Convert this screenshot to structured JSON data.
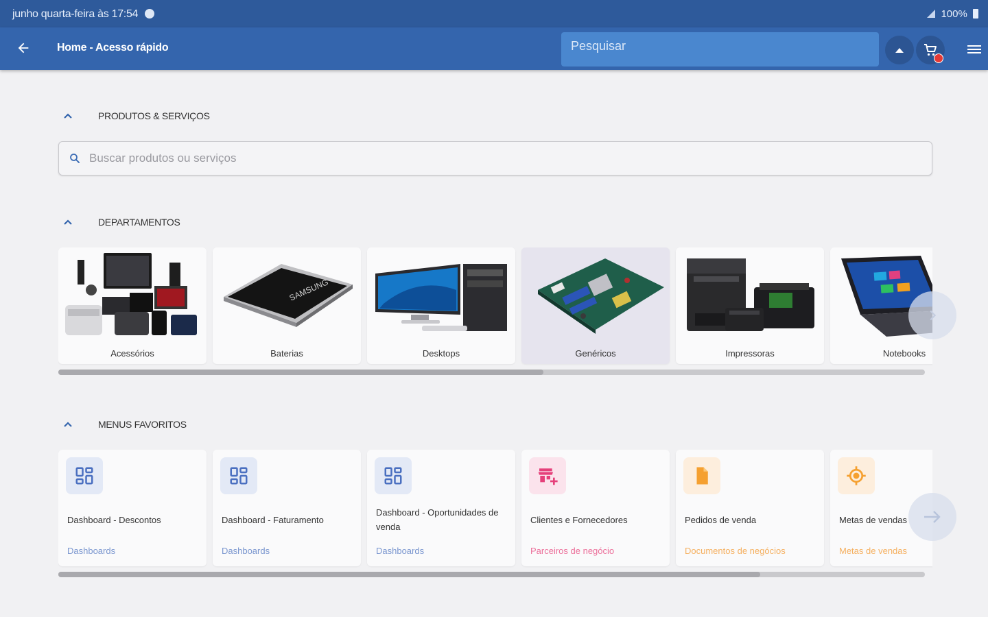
{
  "status_bar": {
    "time_text": "junho quarta-feira às 17:54",
    "battery": "100%"
  },
  "app_bar": {
    "breadcrumb": "Home - Acesso rápido",
    "search_placeholder": "Pesquisar",
    "colors": {
      "bar": "#3465ad",
      "status": "#2e5a9b",
      "search": "#4a87cf"
    }
  },
  "sections": {
    "products": {
      "title": "PRODUTOS & SERVIÇOS",
      "search_placeholder": "Buscar produtos ou serviços"
    },
    "departments": {
      "title": "DEPARTAMENTOS"
    },
    "favorites": {
      "title": "MENUS FAVORITOS"
    }
  },
  "departments": [
    {
      "label": "Acessórios",
      "image": "electronics-group-image"
    },
    {
      "label": "Baterias",
      "image": "battery-image"
    },
    {
      "label": "Desktops",
      "image": "desktop-computer-image"
    },
    {
      "label": "Genéricos",
      "image": "motherboard-image",
      "selected": true
    },
    {
      "label": "Impressoras",
      "image": "printers-image"
    },
    {
      "label": "Notebooks",
      "image": "laptop-image"
    }
  ],
  "favorites": [
    {
      "title": "Dashboard - Descontos",
      "category": "Dashboards",
      "icon": "dashboard-icon",
      "color": "#4a6fc0",
      "bg": "#e3e9f6"
    },
    {
      "title": "Dashboard - Faturamento",
      "category": "Dashboards",
      "icon": "dashboard-icon",
      "color": "#4a6fc0",
      "bg": "#e3e9f6"
    },
    {
      "title": "Dashboard - Oportunidades de venda",
      "category": "Dashboards",
      "icon": "dashboard-icon",
      "color": "#4a6fc0",
      "bg": "#e3e9f6"
    },
    {
      "title": "Clientes e Fornecedores",
      "category": "Parceiros de negócio",
      "icon": "store-add-icon",
      "color": "#e5407a",
      "bg": "#fbe3ec"
    },
    {
      "title": "Pedidos de venda",
      "category": "Documentos de negócios",
      "icon": "document-icon",
      "color": "#f5a030",
      "bg": "#fdeedd"
    },
    {
      "title": "Metas de vendas",
      "category": "Metas de vendas",
      "icon": "target-icon",
      "color": "#f5a030",
      "bg": "#fdeedd"
    }
  ],
  "scroll": {
    "departments_thumb_fraction": 0.56,
    "favorites_thumb_fraction": 0.81
  }
}
